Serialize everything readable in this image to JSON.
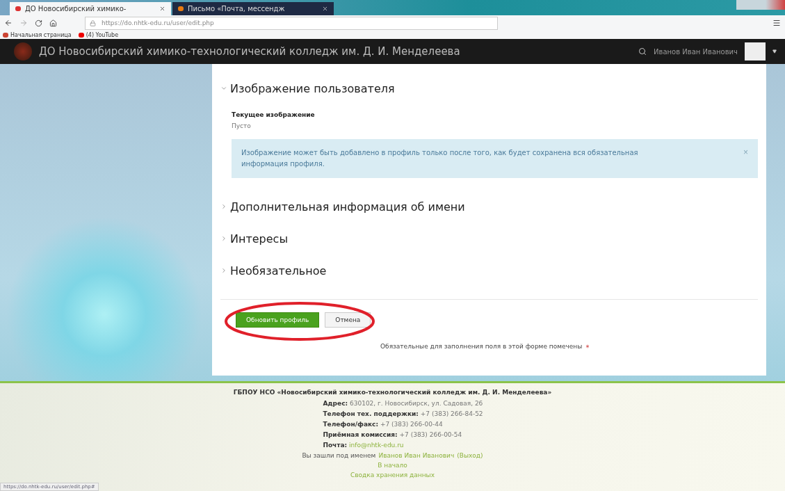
{
  "browser": {
    "tabs": [
      {
        "label": "ДО Новосибирский химико-",
        "selected": true
      },
      {
        "label": "Письмо «Почта, мессендж",
        "selected": false
      }
    ],
    "url": "https://do.nhtk-edu.ru/user/edit.php",
    "bookmarks": [
      {
        "label": "Начальная страница",
        "kind": "home"
      },
      {
        "label": "(4) YouTube",
        "kind": "video"
      }
    ],
    "status_url": "https://do.nhtk-edu.ru/user/edit.php#"
  },
  "site": {
    "title": "ДО Новосибирский химико-технологический колледж им. Д. И. Менделеева",
    "user": "Иванов Иван Иванович"
  },
  "form": {
    "sections": [
      {
        "title": "Изображение пользователя",
        "expanded": true,
        "field_label": "Текущее изображение",
        "field_value": "Пусто",
        "alert": "Изображение может быть добавлено в профиль только после того, как будет сохранена вся обязательная информация профиля.",
        "alert_close": "×"
      },
      {
        "title": "Дополнительная информация об имени",
        "expanded": false
      },
      {
        "title": "Интересы",
        "expanded": false
      },
      {
        "title": "Необязательное",
        "expanded": false
      }
    ],
    "buttons": [
      {
        "label": "Обновить профиль",
        "kind": "primary"
      },
      {
        "label": "Отмена",
        "kind": "secondary"
      }
    ],
    "required_note": "Обязательные для заполнения поля в этой форме помечены"
  },
  "footer": {
    "title": "ГБПОУ НСО «Новосибирский химико-технологический колледж им. Д. И. Менделеева»",
    "contacts": [
      {
        "label": "Адрес:",
        "value": "630102, г. Новосибирск, ул. Садовая, 26",
        "kind": "text"
      },
      {
        "label": "Телефон тех. поддержки:",
        "value": "+7 (383) 266-84-52",
        "kind": "text"
      },
      {
        "label": "Телефон/факс:",
        "value": "+7 (383) 266-00-44",
        "kind": "text"
      },
      {
        "label": "Приёмная комиссия:",
        "value": "+7 (383) 266-00-54",
        "kind": "text"
      },
      {
        "label": "Почта:",
        "value": "info@nhtk-edu.ru",
        "kind": "link"
      }
    ],
    "login_text": "Вы зашли под именем",
    "login_user": "Иванов Иван Иванович",
    "logout": "(Выход)",
    "links": [
      "В начало",
      "Сводка хранения данных"
    ]
  }
}
